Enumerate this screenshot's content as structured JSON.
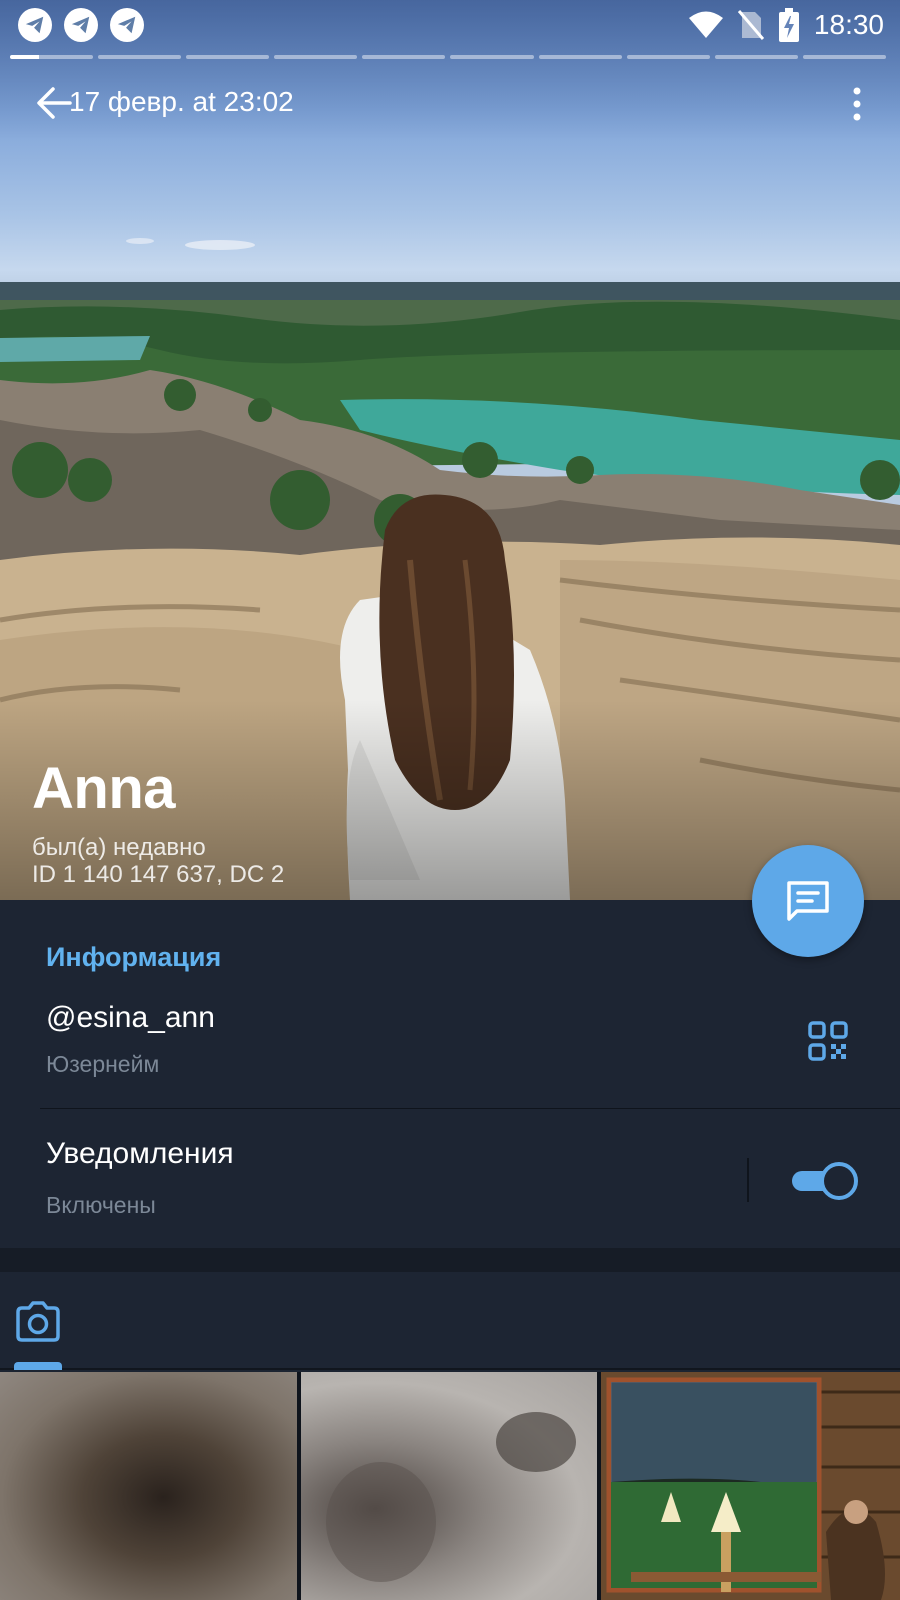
{
  "status_bar": {
    "time": "18:30",
    "left_icons": [
      "telegram-icon",
      "telegram-icon",
      "telegram-icon"
    ],
    "right_icons": [
      "wifi-icon",
      "no-sim-icon",
      "battery-charging-icon"
    ]
  },
  "story_progress": {
    "segments": 10,
    "active_index": 0
  },
  "top_bar": {
    "title": "17 февр. at 23:02",
    "back_icon": "arrow-left-icon",
    "menu_icon": "more-vert-icon"
  },
  "profile": {
    "name": "Anna",
    "status": "был(а) недавно",
    "id_line": "ID 1 140 147 637, DC 2"
  },
  "fab": {
    "icon": "message-icon"
  },
  "info": {
    "title": "Информация",
    "username": {
      "value": "@esina_ann",
      "label": "Юзернейм",
      "icon": "qr-code-icon"
    },
    "notifications": {
      "value": "Уведомления",
      "label": "Включены",
      "enabled": true
    }
  },
  "media_tabs": {
    "active_icon": "camera-icon"
  },
  "colors": {
    "accent": "#5ea8e8",
    "section_title": "#61b2ef",
    "background": "#1d2533",
    "secondary_text": "#7c8897"
  }
}
